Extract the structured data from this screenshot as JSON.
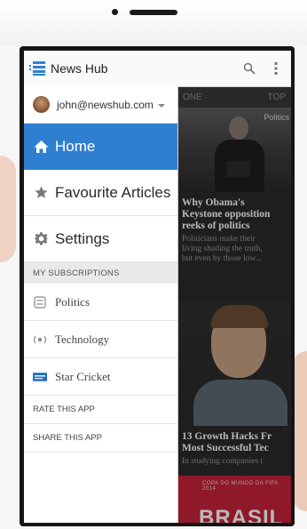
{
  "app": {
    "title": "News Hub",
    "accent_color": "#2f7fd1",
    "icons": [
      "menu-list-icon",
      "search-icon",
      "overflow-menu-icon"
    ]
  },
  "account": {
    "email": "john@newshub.com"
  },
  "drawer": {
    "nav": [
      {
        "label": "Home",
        "icon": "home-icon",
        "active": true
      },
      {
        "label": "Favourite Articles",
        "icon": "star-icon",
        "active": false
      },
      {
        "label": "Settings",
        "icon": "gear-icon",
        "active": false
      }
    ],
    "subscriptions_header": "MY SUBSCRIPTIONS",
    "subscriptions": [
      {
        "label": "Politics",
        "icon": "politics-icon"
      },
      {
        "label": "Technology",
        "icon": "technology-icon"
      },
      {
        "label": "Star Cricket",
        "icon": "star-cricket-logo-icon"
      }
    ],
    "rate_label": "RATE THIS APP",
    "share_label": "SHARE THIS APP"
  },
  "content": {
    "tabs": [
      "ONE",
      "TOP"
    ],
    "articles": [
      {
        "category": "Politics",
        "title_lines": [
          "Why Obama's",
          "Keystone opposition",
          "reeks of politics"
        ],
        "snippet_lines": [
          "Politicians make their",
          "living shading the truth,",
          "but even by those low..."
        ]
      },
      {
        "title_lines": [
          "13 Growth Hacks Fr",
          "Most Successful Tec"
        ],
        "snippet_lines": [
          "In studying companies t"
        ]
      },
      {
        "banner_small": "COPA DO MUNDO DA FIFA 2014",
        "banner_big": "BRASIL"
      }
    ]
  }
}
